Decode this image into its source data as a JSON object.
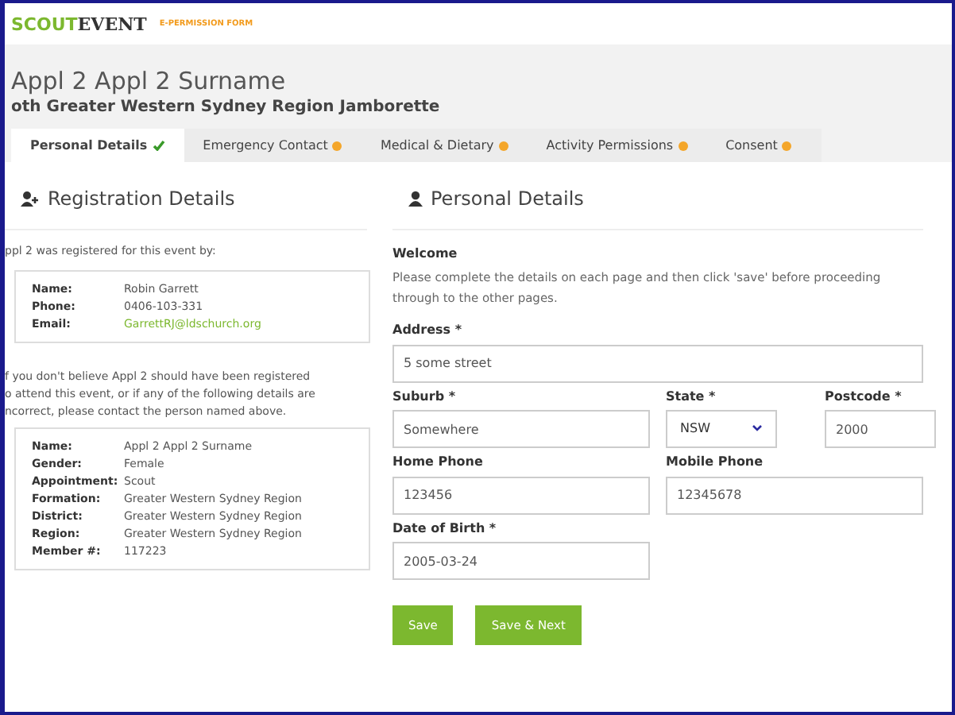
{
  "header": {
    "logo_left": "SCOUT",
    "logo_right": "EVENT",
    "form_label": "E-PERMISSION FORM"
  },
  "title": "Appl 2 Appl 2 Surname",
  "subtitle": "oth Greater Western Sydney Region Jamborette",
  "tabs": [
    {
      "label": "Personal Details",
      "selected": true,
      "kind": "done"
    },
    {
      "label": "Emergency Contact",
      "selected": false,
      "kind": "pending"
    },
    {
      "label": "Medical & Dietary",
      "selected": false,
      "kind": "pending"
    },
    {
      "label": "Activity Permissions",
      "selected": false,
      "kind": "pending"
    },
    {
      "label": "Consent",
      "selected": false,
      "kind": "pending"
    }
  ],
  "registration": {
    "heading": "Registration Details",
    "intro": "ppl 2 was registered for this event by:",
    "registrant": [
      {
        "label": "Name:",
        "value": "Robin Garrett",
        "kind": "text"
      },
      {
        "label": "Phone:",
        "value": "0406-103-331",
        "kind": "text"
      },
      {
        "label": "Email:",
        "value": "GarrettRJ@ldschurch.org",
        "kind": "link"
      }
    ],
    "notice": [
      "f you don't believe Appl 2 should have been registered",
      "o attend this event, or if any of the following details are",
      "ncorrect, please contact the person named above."
    ],
    "member": [
      {
        "label": "Name:",
        "value": "Appl 2 Appl 2 Surname"
      },
      {
        "label": "Gender:",
        "value": "Female"
      },
      {
        "label": "Appointment:",
        "value": "Scout"
      },
      {
        "label": "Formation:",
        "value": "Greater Western Sydney Region"
      },
      {
        "label": "District:",
        "value": "Greater Western Sydney Region"
      },
      {
        "label": "Region:",
        "value": "Greater Western Sydney Region"
      },
      {
        "label": "Member #:",
        "value": "117223"
      }
    ]
  },
  "personal": {
    "heading": "Personal Details",
    "welcome": "Welcome",
    "intro": "Please complete the details on each page and then click 'save' before proceeding through to the other pages.",
    "address": {
      "label": "Address *",
      "value": "5 some street"
    },
    "suburb": {
      "label": "Suburb *",
      "value": "Somewhere"
    },
    "state": {
      "label": "State *",
      "value": "NSW"
    },
    "postcode": {
      "label": "Postcode *",
      "value": "2000"
    },
    "home_phone": {
      "label": "Home Phone",
      "value": "123456"
    },
    "mobile_phone": {
      "label": "Mobile Phone",
      "value": "12345678"
    },
    "dob": {
      "label": "Date of Birth *",
      "value": "2005-03-24"
    },
    "buttons": [
      "Save",
      "Save & Next"
    ]
  }
}
